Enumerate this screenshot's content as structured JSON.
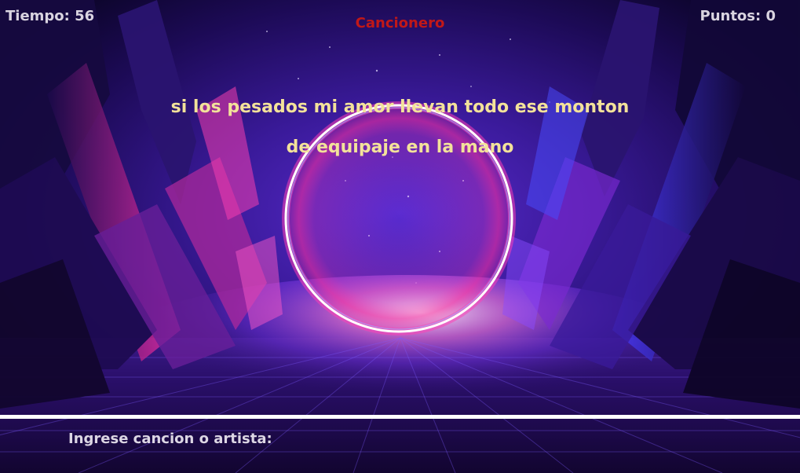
{
  "hud": {
    "time_label": "Tiempo: 56",
    "score_label": "Puntos: 0"
  },
  "game": {
    "title": "Cancionero"
  },
  "lyrics": {
    "line1": "si los pesados mi amor llevan todo ese monton",
    "line2": "de equipaje en la mano"
  },
  "answer": {
    "prompt": "Ingrese cancion o artista:",
    "value": ""
  },
  "colors": {
    "title": "#c01818",
    "lyrics": "#f3e29a",
    "hud": "#d9d4e0",
    "ring": "#ffffff",
    "accent_pink": "#ff2fb0",
    "accent_blue": "#3a4cff"
  }
}
